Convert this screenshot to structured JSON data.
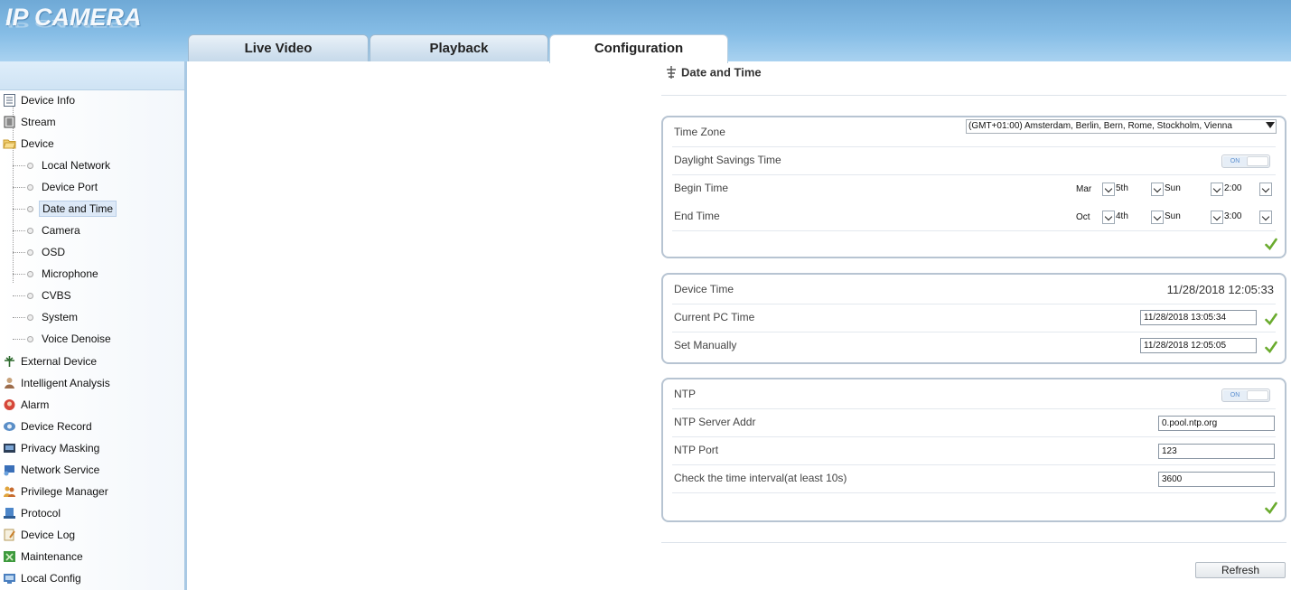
{
  "app": {
    "logo_text": "IP CAMERA"
  },
  "tabs": [
    {
      "label": "Live Video"
    },
    {
      "label": "Playback"
    },
    {
      "label": "Configuration",
      "active": true
    }
  ],
  "sidebar": {
    "items": [
      {
        "label": "Device Info",
        "icon": "document-icon"
      },
      {
        "label": "Stream",
        "icon": "film-icon"
      },
      {
        "label": "Device",
        "icon": "folder-icon"
      },
      {
        "label": "Local Network",
        "sub": true
      },
      {
        "label": "Device Port",
        "sub": true
      },
      {
        "label": "Date and Time",
        "sub": true,
        "selected": true
      },
      {
        "label": "Camera",
        "sub": true
      },
      {
        "label": "OSD",
        "sub": true
      },
      {
        "label": "Microphone",
        "sub": true
      },
      {
        "label": "CVBS",
        "sub": true
      },
      {
        "label": "System",
        "sub": true
      },
      {
        "label": "Voice Denoise",
        "sub": true
      },
      {
        "label": "External Device",
        "icon": "plug-icon"
      },
      {
        "label": "Intelligent Analysis",
        "icon": "analysis-icon"
      },
      {
        "label": "Alarm",
        "icon": "alarm-icon"
      },
      {
        "label": "Device Record",
        "icon": "record-icon"
      },
      {
        "label": "Privacy Masking",
        "icon": "mask-icon"
      },
      {
        "label": "Network Service",
        "icon": "network-icon"
      },
      {
        "label": "Privilege Manager",
        "icon": "users-icon"
      },
      {
        "label": "Protocol",
        "icon": "protocol-icon"
      },
      {
        "label": "Device Log",
        "icon": "log-icon"
      },
      {
        "label": "Maintenance",
        "icon": "maintenance-icon"
      },
      {
        "label": "Local Config",
        "icon": "local-config-icon"
      }
    ]
  },
  "page": {
    "title": "Date and Time"
  },
  "timezone_panel": {
    "timezone_label": "Time Zone",
    "timezone_value": "(GMT+01:00) Amsterdam, Berlin, Bern, Rome, Stockholm, Vienna",
    "dst_label": "Daylight Savings Time",
    "dst_toggle": "ON",
    "begin_label": "Begin Time",
    "begin": {
      "month": "Mar",
      "week": "5th",
      "day": "Sun",
      "time": "2:00"
    },
    "end_label": "End Time",
    "end": {
      "month": "Oct",
      "week": "4th",
      "day": "Sun",
      "time": "3:00"
    }
  },
  "time_panel": {
    "device_time_label": "Device Time",
    "device_time_value": "11/28/2018 12:05:33",
    "pc_time_label": "Current PC Time",
    "pc_time_value": "11/28/2018 13:05:34",
    "manual_label": "Set Manually",
    "manual_value": "11/28/2018 12:05:05"
  },
  "ntp_panel": {
    "ntp_label": "NTP",
    "ntp_toggle": "ON",
    "server_label": "NTP Server Addr",
    "server_value": "0.pool.ntp.org",
    "port_label": "NTP Port",
    "port_value": "123",
    "interval_label": "Check the time interval(at least 10s)",
    "interval_value": "3600"
  },
  "buttons": {
    "refresh": "Refresh"
  },
  "colors": {
    "header": "#86bde6",
    "accent": "#6fa9d6",
    "check": "#6aab2e"
  }
}
